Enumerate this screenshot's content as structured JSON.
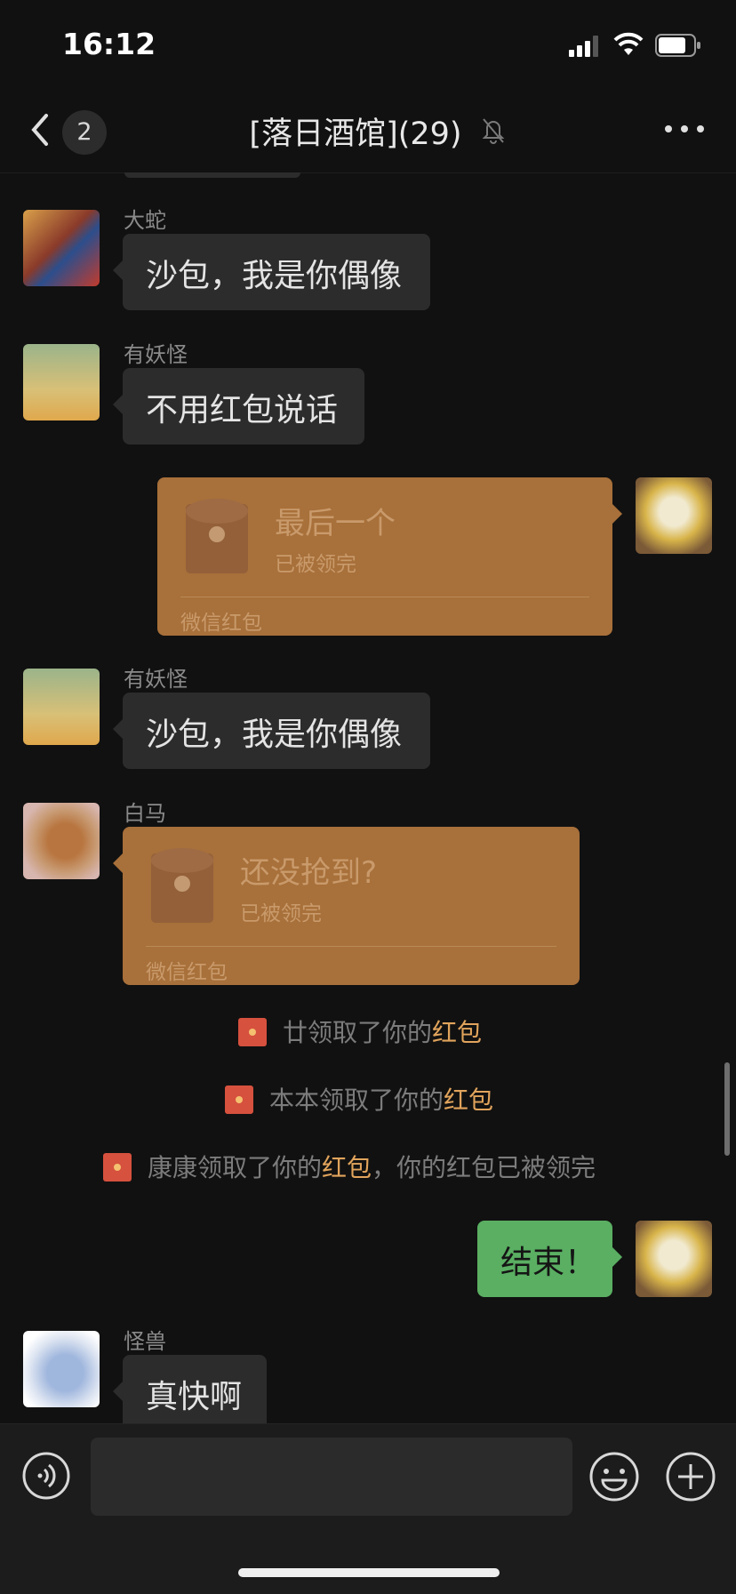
{
  "status_bar": {
    "time": "16:12"
  },
  "header": {
    "unread_count": "2",
    "title": "[落日酒馆](29)"
  },
  "messages": [
    {
      "sender": "大蛇",
      "text": "沙包，我是你偶像"
    },
    {
      "sender": "有妖怪",
      "text": "不用红包说话"
    },
    {
      "packet_title": "最后一个",
      "packet_status": "已被领完",
      "packet_footer": "微信红包"
    },
    {
      "sender": "有妖怪",
      "text": "沙包，我是你偶像"
    },
    {
      "sender": "白马",
      "packet_title": "还没抢到?",
      "packet_status": "已被领完",
      "packet_footer": "微信红包"
    },
    {
      "text": "结束！"
    },
    {
      "sender": "怪兽",
      "text": "真快啊"
    }
  ],
  "notices": [
    {
      "before": "廿领取了你的",
      "link": "红包",
      "after": ""
    },
    {
      "before": "本本领取了你的",
      "link": "红包",
      "after": ""
    },
    {
      "before": "康康领取了你的",
      "link": "红包",
      "after": "，你的红包已被领完"
    }
  ],
  "colors": {
    "background": "#111111",
    "bubble": "#2c2c2c",
    "self_bubble": "#5aaf62",
    "red_packet": "#a8703a",
    "link": "#e1a45c"
  },
  "icons": [
    "back-icon",
    "mute-bell-icon",
    "more-icon",
    "voice-icon",
    "emoji-icon",
    "plus-icon"
  ]
}
